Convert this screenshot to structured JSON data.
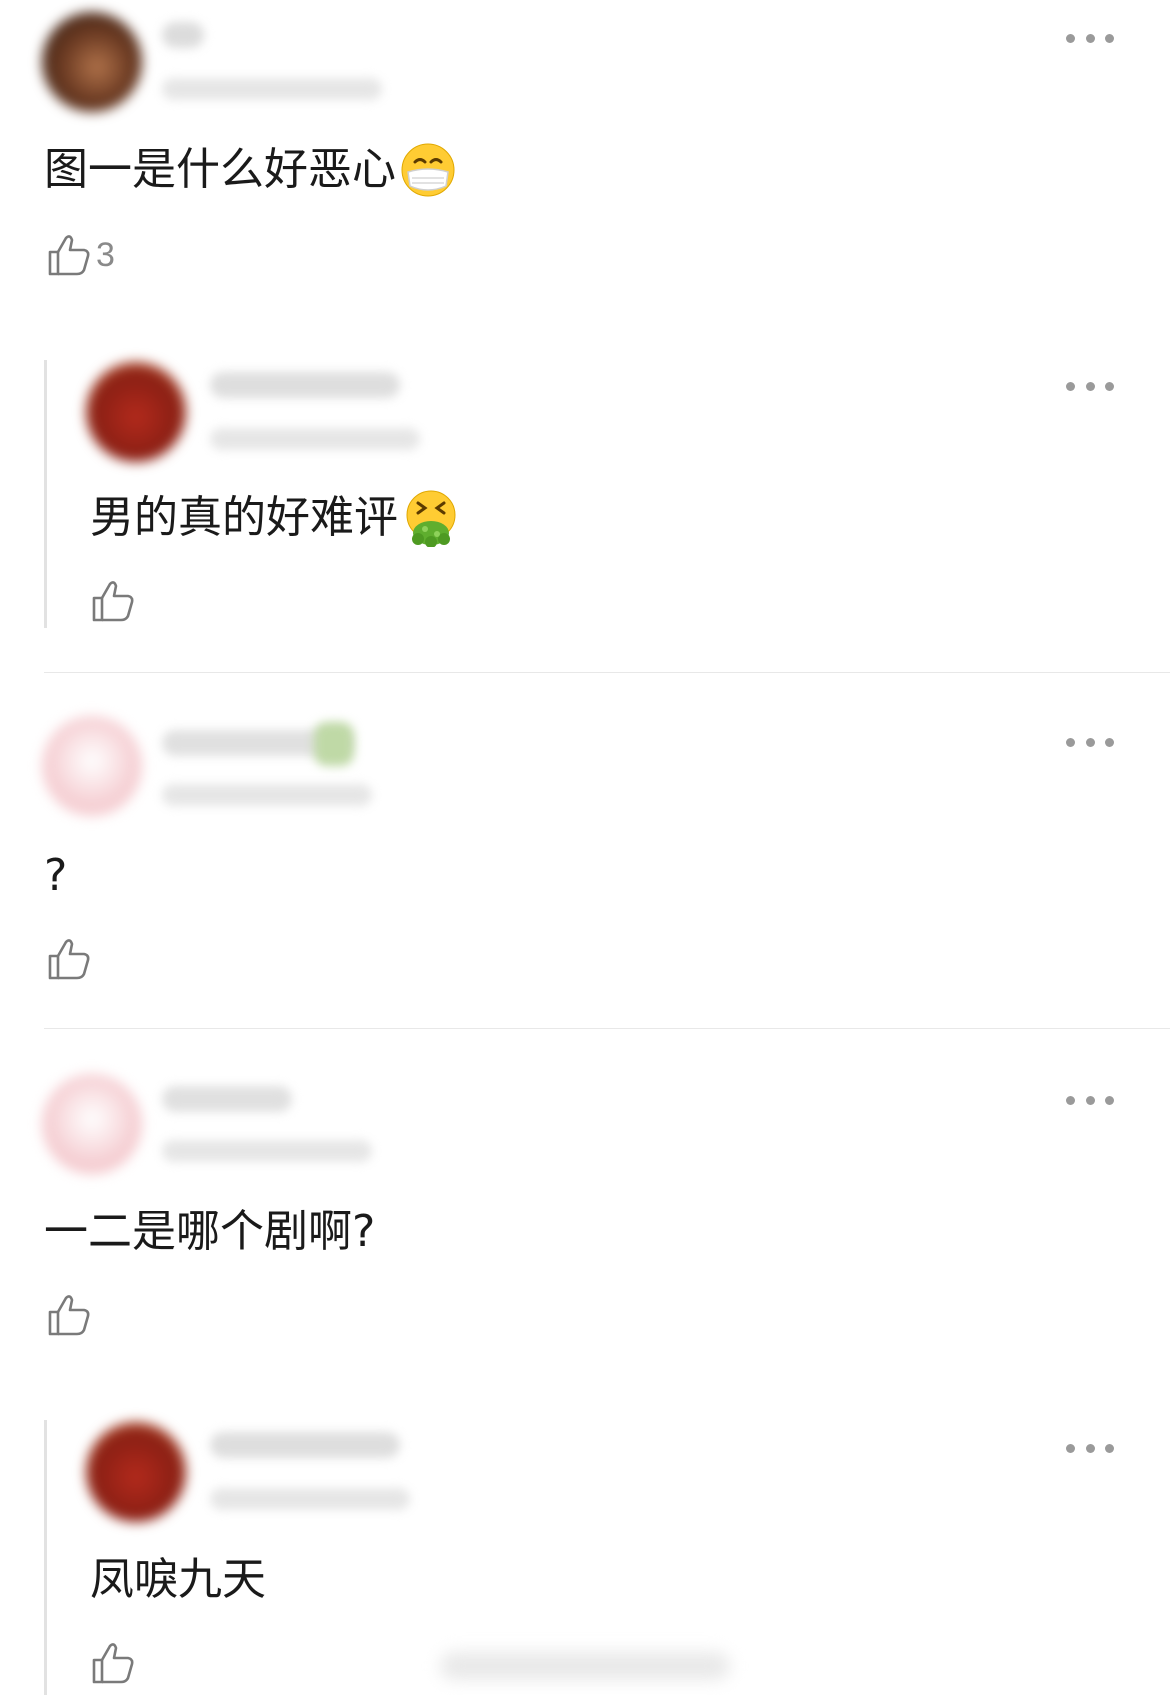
{
  "comments": [
    {
      "text": "图一是什么好恶心",
      "emoji": "mask-face-emoji",
      "likes": "3"
    },
    {
      "text": "男的真的好难评",
      "emoji": "vomiting-face-emoji",
      "likes": ""
    },
    {
      "text": "?",
      "likes": ""
    },
    {
      "text": "一二是哪个剧啊?",
      "likes": ""
    },
    {
      "text": "凤唳九天",
      "likes": ""
    }
  ],
  "icons": {
    "like": "thumbs-up-icon",
    "more": "more-dots-icon"
  },
  "colors": {
    "avatar_brown": "#6b3a22",
    "avatar_red": "#b32a1c",
    "avatar_pink": "#f6d2d6"
  }
}
